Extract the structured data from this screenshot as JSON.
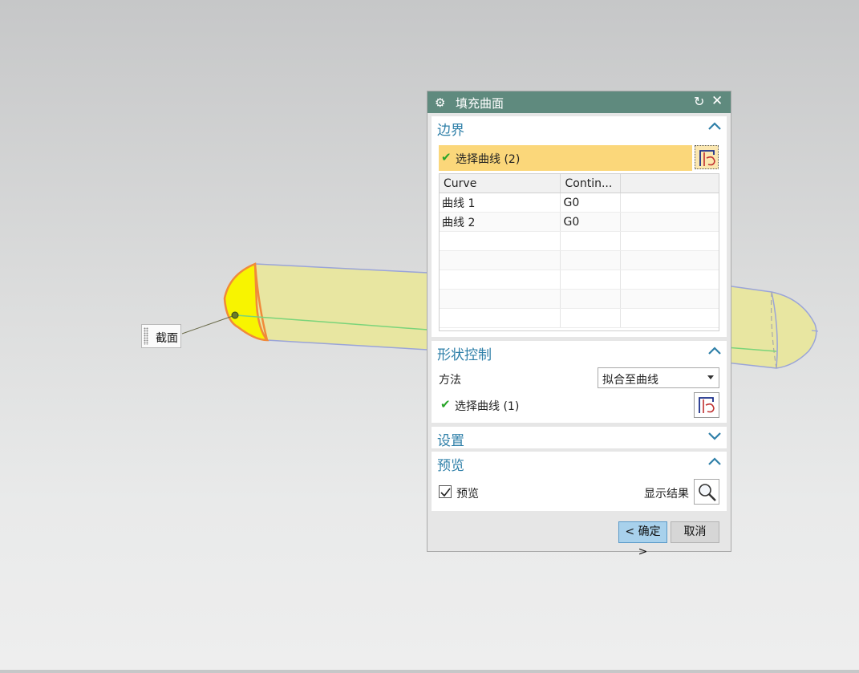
{
  "viewport": {
    "callout_label": "截面",
    "colors": {
      "tube_fill": "#e8e6a1",
      "cap_fill": "#f8f400",
      "cap_edge": "#f08a3a",
      "edge_line": "#9aa4d8",
      "center_line": "#7ad47a"
    }
  },
  "dialog": {
    "title": "填充曲面",
    "title_icon": "gear-icon",
    "reset_icon": "reset-icon",
    "close_icon": "close-icon",
    "title_color": "#5f8a7e",
    "boundary": {
      "header": "边界",
      "select_label": "选择曲线 (2)",
      "columns": [
        "Curve",
        "Contin...",
        ""
      ],
      "rows": [
        {
          "curve": "曲线 1",
          "continuity": "G0"
        },
        {
          "curve": "曲线 2",
          "continuity": "G0"
        }
      ]
    },
    "shape_control": {
      "header": "形状控制",
      "method_label": "方法",
      "method_value": "拟合至曲线",
      "select_label": "选择曲线 (1)"
    },
    "settings": {
      "header": "设置"
    },
    "preview": {
      "header": "预览",
      "checkbox_label": "预览",
      "checked": true,
      "show_result_label": "显示结果"
    },
    "buttons": {
      "ok": "< 确定 >",
      "cancel": "取消"
    },
    "accent_color": "#2e7fa8",
    "selection_highlight": "#fbd77a"
  }
}
